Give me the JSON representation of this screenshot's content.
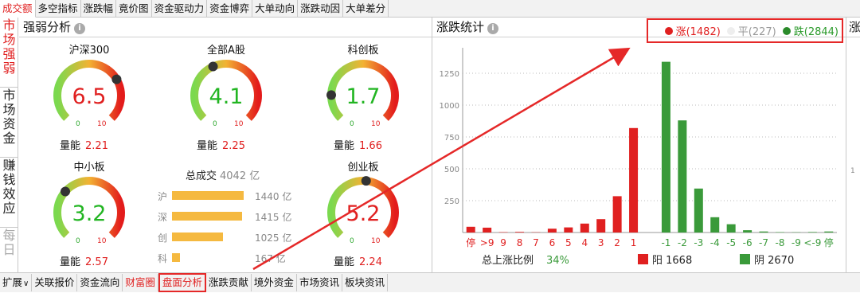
{
  "top_tabs": [
    "成交额",
    "多空指标",
    "涨跌幅",
    "竟价图",
    "资金驱动力",
    "资金博弈",
    "大单动向",
    "涨跌动因",
    "大单差分"
  ],
  "left_tabs": [
    {
      "label": "市场强弱",
      "state": "active"
    },
    {
      "label": "市场资金",
      "state": "normal"
    },
    {
      "label": "赚钱效应",
      "state": "normal"
    },
    {
      "label": "每日",
      "state": "muted"
    }
  ],
  "left_panel": {
    "title": "强弱分析",
    "info_icon": "i",
    "gauges": [
      {
        "name": "沪深300",
        "value": "6.5",
        "color": "#e02020",
        "needle": 0.72,
        "min": "0",
        "max": "10",
        "energy_label": "量能",
        "energy": "2.21"
      },
      {
        "name": "全部A股",
        "value": "4.1",
        "color": "#22b522",
        "needle": 0.41,
        "min": "0",
        "max": "10",
        "energy_label": "量能",
        "energy": "2.25"
      },
      {
        "name": "科创板",
        "value": "1.7",
        "color": "#22b522",
        "needle": 0.17,
        "min": "0",
        "max": "10",
        "energy_label": "量能",
        "energy": "1.66"
      },
      {
        "name": "中小板",
        "value": "3.2",
        "color": "#22b522",
        "needle": 0.32,
        "min": "0",
        "max": "10",
        "energy_label": "量能",
        "energy": "2.57"
      },
      {
        "name": "创业板",
        "value": "5.2",
        "color": "#e02020",
        "needle": 0.52,
        "min": "0",
        "max": "10",
        "energy_label": "量能",
        "energy": "2.24"
      }
    ],
    "turnover": {
      "title": "总成交",
      "total": "4042 亿",
      "rows": [
        {
          "label": "沪",
          "amount": "1440 亿",
          "value": 1440
        },
        {
          "label": "深",
          "amount": "1415 亿",
          "value": 1415
        },
        {
          "label": "创",
          "amount": "1025 亿",
          "value": 1025
        },
        {
          "label": "科",
          "amount": "167 亿",
          "value": 167
        }
      ]
    }
  },
  "right_panel": {
    "title": "涨跌统计",
    "info_icon": "i",
    "next_title": "涨",
    "legend": {
      "up": "涨(1482)",
      "flat": "平(227)",
      "down": "跌(2844)"
    },
    "footer": {
      "ratio_label": "总上涨比例",
      "ratio": "34%",
      "yang": "阳 1668",
      "yin": "阴 2670"
    }
  },
  "chart_data": {
    "type": "bar",
    "categories": [
      "停",
      ">9",
      "9",
      "8",
      "7",
      "6",
      "5",
      "4",
      "3",
      "2",
      "1",
      "",
      "-1",
      "-2",
      "-3",
      "-4",
      "-5",
      "-6",
      "-7",
      "-8",
      "-9",
      "<-9",
      "停"
    ],
    "values": [
      45,
      38,
      3,
      5,
      2,
      30,
      40,
      70,
      105,
      285,
      820,
      0,
      1340,
      880,
      345,
      120,
      65,
      18,
      8,
      3,
      2,
      4,
      8
    ],
    "colors": [
      "#e02020",
      "#e02020",
      "#e02020",
      "#e02020",
      "#e02020",
      "#e02020",
      "#e02020",
      "#e02020",
      "#e02020",
      "#e02020",
      "#e02020",
      "#cccccc",
      "#3a9a3a",
      "#3a9a3a",
      "#3a9a3a",
      "#3a9a3a",
      "#3a9a3a",
      "#3a9a3a",
      "#3a9a3a",
      "#3a9a3a",
      "#3a9a3a",
      "#3a9a3a",
      "#3a9a3a"
    ],
    "y_ticks": [
      "250",
      "500",
      "750",
      "1000",
      "1250"
    ],
    "ylim": [
      0,
      1450
    ],
    "grid": true,
    "right_axis_tick": "1"
  },
  "bottom_tabs": [
    {
      "label": "扩展",
      "chevron": "∨",
      "state": "normal"
    },
    {
      "label": "关联报价",
      "state": "normal"
    },
    {
      "label": "资金流向",
      "state": "normal"
    },
    {
      "label": "财富圈",
      "state": "red"
    },
    {
      "label": "盘面分析",
      "state": "boxed"
    },
    {
      "label": "涨跌贡献",
      "state": "normal"
    },
    {
      "label": "境外资金",
      "state": "normal"
    },
    {
      "label": "市场资讯",
      "state": "normal"
    },
    {
      "label": "板块资讯",
      "state": "normal"
    }
  ]
}
